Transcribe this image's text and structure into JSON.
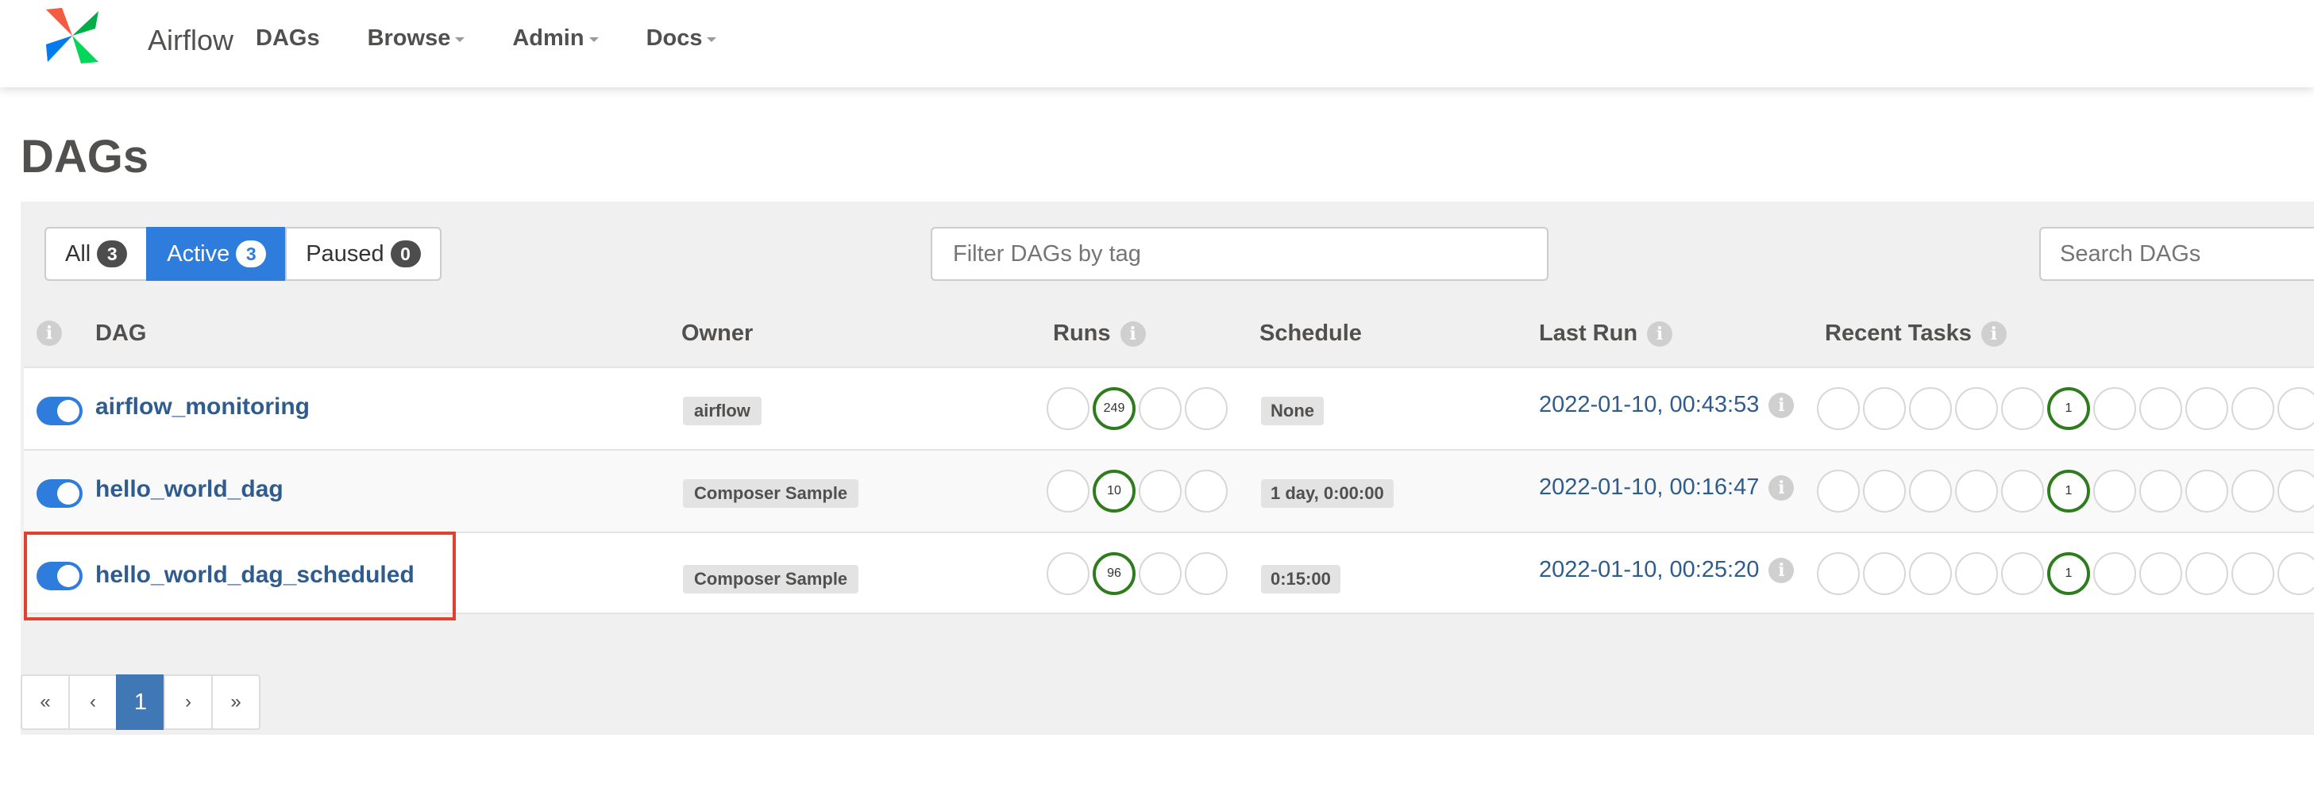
{
  "brand": {
    "name": "Airflow",
    "logo_icon": "airflow-pinwheel-icon"
  },
  "nav": [
    {
      "label": "DAGs",
      "dropdown": false
    },
    {
      "label": "Browse",
      "dropdown": true
    },
    {
      "label": "Admin",
      "dropdown": true
    },
    {
      "label": "Docs",
      "dropdown": true
    }
  ],
  "page_title": "DAGs",
  "filters": {
    "all": {
      "label": "All",
      "count": "3"
    },
    "active": {
      "label": "Active",
      "count": "3",
      "selected": true
    },
    "paused": {
      "label": "Paused",
      "count": "0"
    },
    "tag_placeholder": "Filter DAGs by tag",
    "search_placeholder": "Search DAGs"
  },
  "columns": {
    "dag": "DAG",
    "owner": "Owner",
    "runs": "Runs",
    "schedule": "Schedule",
    "last_run": "Last Run",
    "recent_tasks": "Recent Tasks",
    "info_glyph": "i"
  },
  "rows": [
    {
      "dag_id": "airflow_monitoring",
      "owner": "airflow",
      "runs_success": "249",
      "schedule": "None",
      "last_run": "2022-01-10, 00:43:53",
      "tasks_success": "1",
      "active": true
    },
    {
      "dag_id": "hello_world_dag",
      "owner": "Composer Sample",
      "runs_success": "10",
      "schedule": "1 day, 0:00:00",
      "last_run": "2022-01-10, 00:16:47",
      "tasks_success": "1",
      "active": true
    },
    {
      "dag_id": "hello_world_dag_scheduled",
      "owner": "Composer Sample",
      "runs_success": "96",
      "schedule": "0:15:00",
      "last_run": "2022-01-10, 00:25:20",
      "tasks_success": "1",
      "active": true,
      "highlighted": true
    }
  ],
  "pagination": {
    "first": "«",
    "prev": "‹",
    "current": "1",
    "next": "›",
    "last": "»"
  },
  "colors": {
    "accent": "#2e7ddd",
    "success": "#2f7c1e",
    "link": "#2f5c8f",
    "highlight": "#e0412e"
  }
}
